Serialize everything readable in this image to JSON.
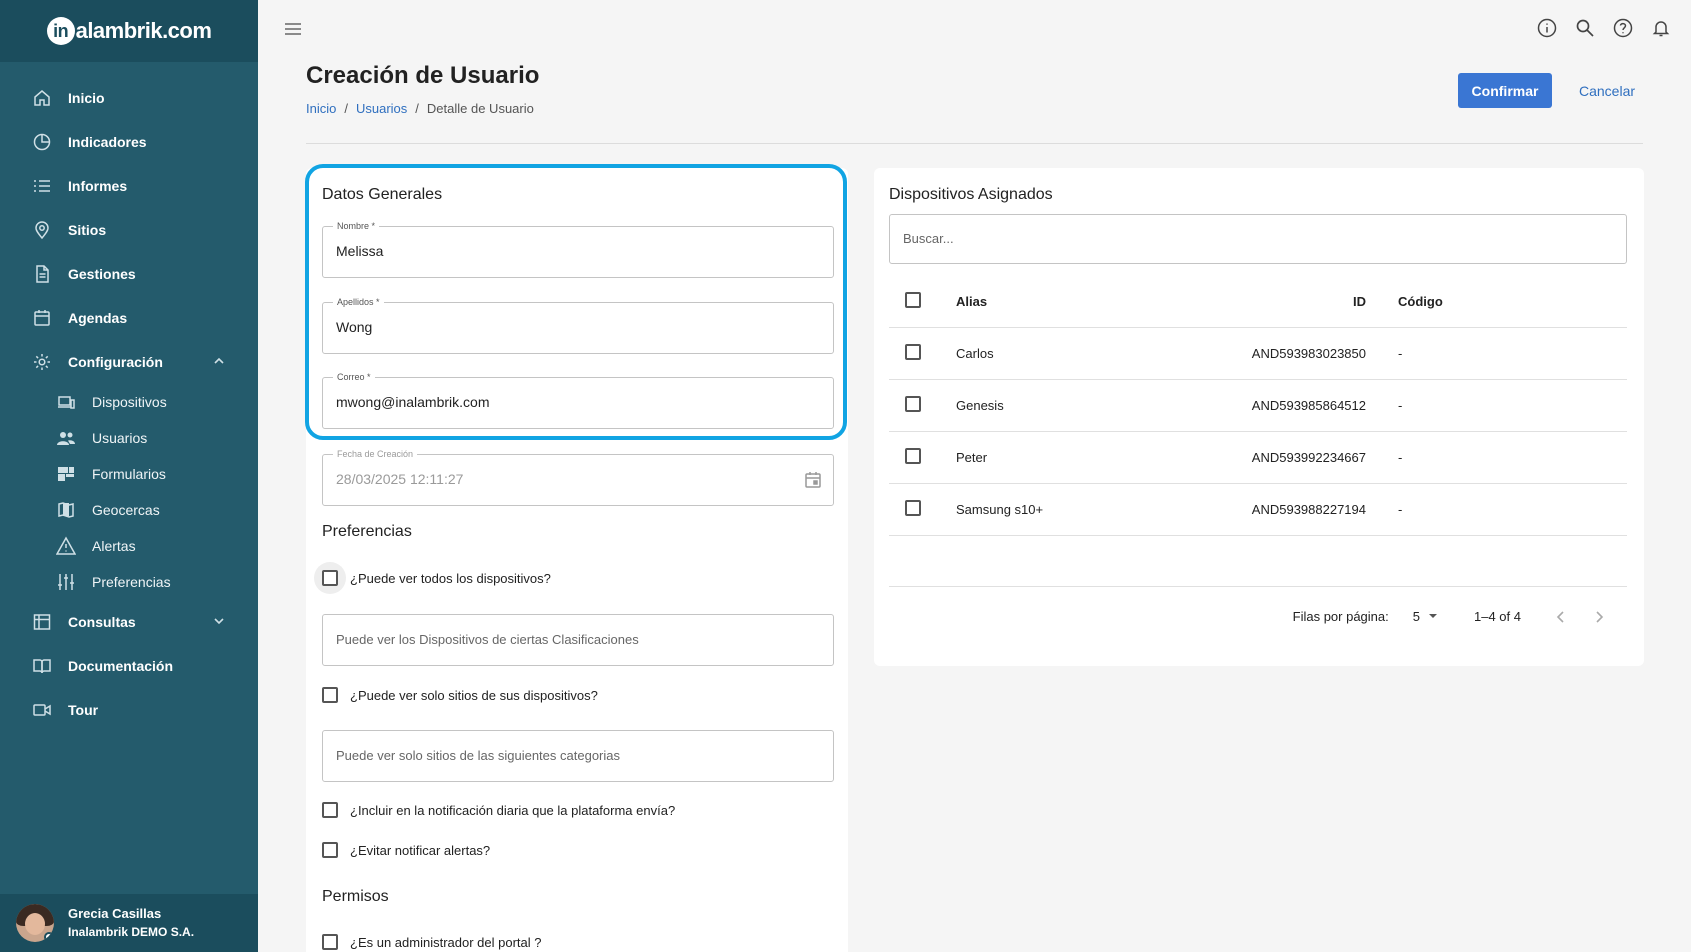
{
  "app": {
    "logo_prefix": "in",
    "logo_text": "alambrik.com"
  },
  "sidebar": {
    "items": [
      {
        "label": "Inicio",
        "icon": "home-icon"
      },
      {
        "label": "Indicadores",
        "icon": "pie-chart-icon"
      },
      {
        "label": "Informes",
        "icon": "list-icon"
      },
      {
        "label": "Sitios",
        "icon": "location-pin-icon"
      },
      {
        "label": "Gestiones",
        "icon": "document-icon"
      },
      {
        "label": "Agendas",
        "icon": "calendar-icon"
      },
      {
        "label": "Configuración",
        "icon": "gear-icon",
        "expanded": true
      }
    ],
    "sub_items": [
      {
        "label": "Dispositivos",
        "icon": "devices-icon"
      },
      {
        "label": "Usuarios",
        "icon": "users-icon"
      },
      {
        "label": "Formularios",
        "icon": "forms-icon"
      },
      {
        "label": "Geocercas",
        "icon": "map-icon"
      },
      {
        "label": "Alertas",
        "icon": "warning-icon"
      },
      {
        "label": "Preferencias",
        "icon": "sliders-icon"
      }
    ],
    "bottom_items": [
      {
        "label": "Consultas",
        "icon": "table-icon"
      },
      {
        "label": "Documentación",
        "icon": "book-icon"
      },
      {
        "label": "Tour",
        "icon": "video-icon"
      }
    ],
    "user": {
      "name": "Grecia Casillas",
      "org": "Inalambrik DEMO S.A."
    }
  },
  "header": {
    "title": "Creación de Usuario",
    "breadcrumb": [
      "Inicio",
      "Usuarios",
      "Detalle de Usuario"
    ],
    "breadcrumb_sep": "/",
    "confirm_label": "Confirmar",
    "cancel_label": "Cancelar"
  },
  "general": {
    "title": "Datos Generales",
    "nombre_label": "Nombre *",
    "nombre_value": "Melissa",
    "apellidos_label": "Apellidos *",
    "apellidos_value": "Wong",
    "correo_label": "Correo *",
    "correo_value": "mwong@inalambrik.com",
    "fecha_label": "Fecha de Creación",
    "fecha_value": "28/03/2025 12:11:27"
  },
  "preferences": {
    "title": "Preferencias",
    "check_all_devices": "¿Puede ver todos los dispositivos?",
    "classifications_placeholder": "Puede ver los Dispositivos de ciertas Clasificaciones",
    "check_own_sites": "¿Puede ver solo sitios de sus dispositivos?",
    "categories_placeholder": "Puede ver solo sitios de las siguientes categorias",
    "check_daily_notification": "¿Incluir en la notificación diaria que la plataforma envía?",
    "check_avoid_alerts": "¿Evitar notificar alertas?"
  },
  "permissions": {
    "title": "Permisos",
    "check_admin": "¿Es un administrador del portal ?"
  },
  "devices": {
    "title": "Dispositivos Asignados",
    "search_placeholder": "Buscar...",
    "columns": {
      "alias": "Alias",
      "id": "ID",
      "code": "Código"
    },
    "rows": [
      {
        "alias": "Carlos",
        "id": "AND593983023850",
        "code": "-"
      },
      {
        "alias": "Genesis",
        "id": "AND593985864512",
        "code": "-"
      },
      {
        "alias": "Peter",
        "id": "AND593992234667",
        "code": "-"
      },
      {
        "alias": "Samsung s10+",
        "id": "AND593988227194",
        "code": "-"
      }
    ],
    "rows_per_page_label": "Filas por página:",
    "rows_per_page": "5",
    "range": "1–4 of 4"
  }
}
